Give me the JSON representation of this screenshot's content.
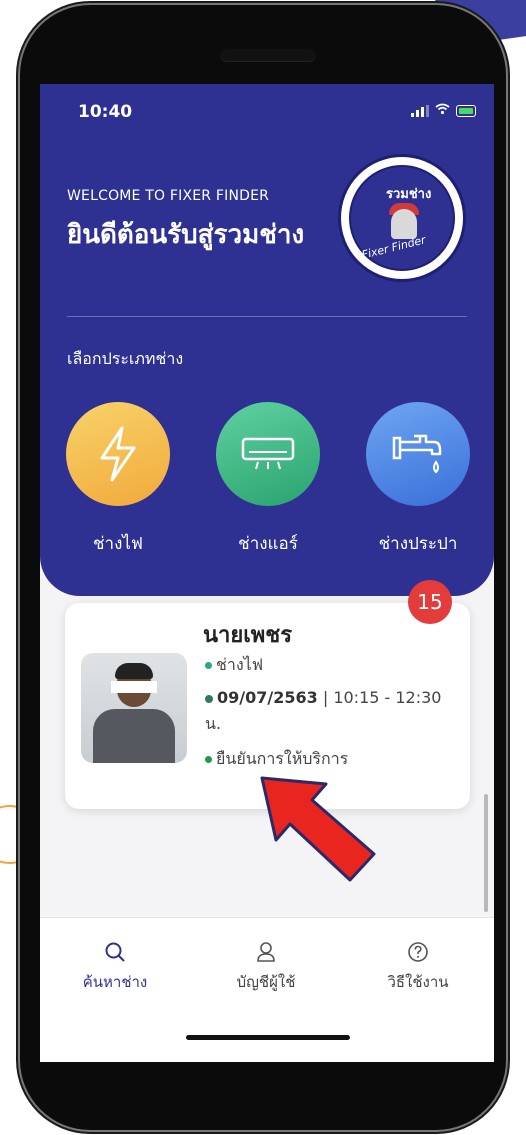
{
  "status": {
    "time": "10:40"
  },
  "header": {
    "welcome_en": "WELCOME TO FIXER FINDER",
    "welcome_th": "ยินดีต้อนรับสู่รวมช่าง",
    "logo_top": "รวมช่าง",
    "logo_bottom": "Fixer Finder"
  },
  "categories": {
    "title": "เลือกประเภทช่าง",
    "items": [
      {
        "label": "ช่างไฟ",
        "icon": "lightning-icon"
      },
      {
        "label": "ช่างแอร์",
        "icon": "air-conditioner-icon"
      },
      {
        "label": "ช่างประปา",
        "icon": "faucet-icon"
      }
    ]
  },
  "booking": {
    "badge": "15",
    "name": "นายเพชร",
    "type": "ช่างไฟ",
    "date": "09/07/2563",
    "time": "| 10:15 - 12:30 น.",
    "status": "ยืนยันการให้บริการ"
  },
  "tabs": [
    {
      "label": "ค้นหาช่าง",
      "icon": "search-icon",
      "active": true
    },
    {
      "label": "บัญชีผู้ใช้",
      "icon": "user-icon",
      "active": false
    },
    {
      "label": "วิธีใช้งาน",
      "icon": "help-icon",
      "active": false
    }
  ],
  "colors": {
    "primary": "#2e3192",
    "badge": "#e23c3c",
    "arrow": "#e8261f"
  }
}
